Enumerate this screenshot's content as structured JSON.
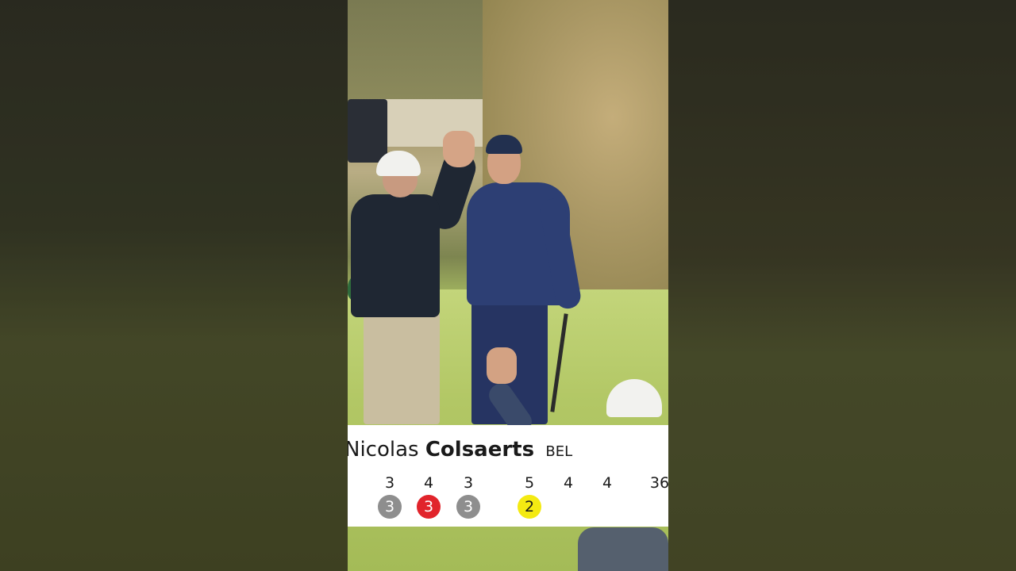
{
  "player": {
    "first_name": "Nicolas",
    "last_name": "Colsaerts",
    "country": "BEL"
  },
  "scorecard": {
    "holes": [
      {
        "par": "3",
        "score": "3",
        "result": "par",
        "color": "#8e8e8e"
      },
      {
        "par": "4",
        "score": "3",
        "result": "birdie",
        "color": "#e1242b"
      },
      {
        "par": "3",
        "score": "3",
        "result": "par",
        "color": "#8e8e8e"
      },
      {
        "par": "",
        "score": "",
        "result": "",
        "color": ""
      },
      {
        "par": "5",
        "score": "2",
        "result": "albatross",
        "color": "#f4ea12"
      },
      {
        "par": "4",
        "score": "",
        "result": "",
        "color": ""
      },
      {
        "par": "4",
        "score": "",
        "result": "",
        "color": ""
      },
      {
        "par": "36",
        "score": "",
        "result": "",
        "color": ""
      }
    ]
  },
  "colors": {
    "graphic_background": "#ffffff",
    "text": "#1a1a1a",
    "par_badge": "#8e8e8e",
    "birdie_badge": "#e1242b",
    "albatross_badge": "#f4ea12"
  }
}
